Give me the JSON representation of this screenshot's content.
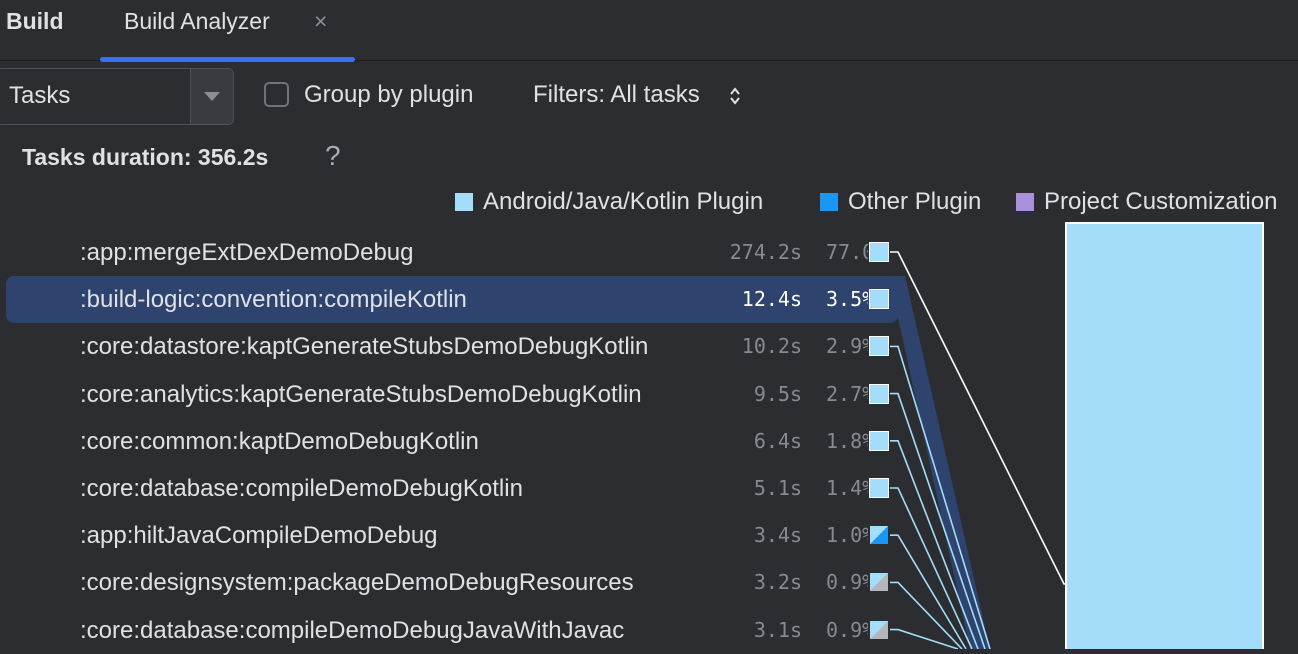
{
  "tabs": {
    "build_label": "Build",
    "analyzer_label": "Build Analyzer",
    "close_glyph": "×"
  },
  "toolbar": {
    "view_select": "Tasks",
    "group_by_plugin_label": "Group by plugin",
    "group_by_plugin_checked": false,
    "filters_label": "Filters: All tasks"
  },
  "summary": {
    "duration_label": "Tasks duration: 356.2s",
    "help_glyph": "?"
  },
  "legend": [
    {
      "label": "Android/Java/Kotlin Plugin",
      "color": "#a3ddfa"
    },
    {
      "label": "Other Plugin",
      "color": "#1b96f3"
    },
    {
      "label": "Project Customization",
      "color": "#a98fdc"
    }
  ],
  "tasks": [
    {
      "name": ":app:mergeExtDexDemoDebug",
      "time": "274.2s",
      "percent": "77.0%",
      "selected": false,
      "swatch": "solid"
    },
    {
      "name": ":build-logic:convention:compileKotlin",
      "time": "12.4s",
      "percent": "3.5%",
      "selected": true,
      "swatch": "solid"
    },
    {
      "name": ":core:datastore:kaptGenerateStubsDemoDebugKotlin",
      "time": "10.2s",
      "percent": "2.9%",
      "selected": false,
      "swatch": "solid"
    },
    {
      "name": ":core:analytics:kaptGenerateStubsDemoDebugKotlin",
      "time": "9.5s",
      "percent": "2.7%",
      "selected": false,
      "swatch": "solid"
    },
    {
      "name": ":core:common:kaptDemoDebugKotlin",
      "time": "6.4s",
      "percent": "1.8%",
      "selected": false,
      "swatch": "solid"
    },
    {
      "name": ":core:database:compileDemoDebugKotlin",
      "time": "5.1s",
      "percent": "1.4%",
      "selected": false,
      "swatch": "solid"
    },
    {
      "name": ":app:hiltJavaCompileDemoDebug",
      "time": "3.4s",
      "percent": "1.0%",
      "selected": false,
      "swatch": "split-blue"
    },
    {
      "name": ":core:designsystem:packageDemoDebugResources",
      "time": "3.2s",
      "percent": "0.9%",
      "selected": false,
      "swatch": "split-gray"
    },
    {
      "name": ":core:database:compileDemoDebugJavaWithJavac",
      "time": "3.1s",
      "percent": "0.9%",
      "selected": false,
      "swatch": "split-gray"
    }
  ],
  "colors": {
    "accent": "#3574f0",
    "selection": "#2e436e",
    "bar": "#a3ddfa",
    "connector": "#a3ddfa"
  }
}
